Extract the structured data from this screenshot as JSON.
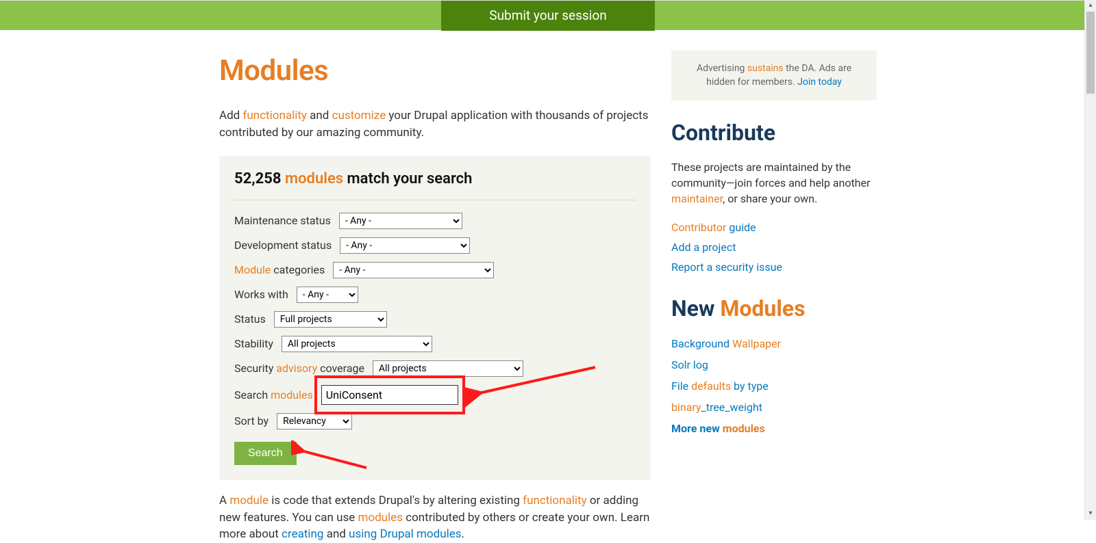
{
  "banner": {
    "cta": "Submit your session"
  },
  "page": {
    "title": "Modules",
    "intro_pre": "Add ",
    "intro_link1": "functionality",
    "intro_mid1": " and ",
    "intro_link2": "customize",
    "intro_post": " your Drupal application with thousands of projects contributed by our amazing community."
  },
  "search": {
    "count": "52,258",
    "word_modules": "modules",
    "heading_rest": " match your search",
    "filters": {
      "maintenance": {
        "label": "Maintenance status",
        "value": "- Any -"
      },
      "development": {
        "label": "Development status",
        "value": "- Any -"
      },
      "categories": {
        "label_pre": "",
        "label_link": "Module",
        "label_post": " categories",
        "value": "- Any -"
      },
      "works_with": {
        "label": "Works with",
        "value": "- Any -"
      },
      "status": {
        "label": "Status",
        "value": "Full projects"
      },
      "stability": {
        "label": "Stability",
        "value": "All projects"
      },
      "security": {
        "label_pre": "Security ",
        "label_link": "advisory",
        "label_post": " coverage",
        "value": "All projects"
      },
      "search_modules": {
        "label_pre": "Search ",
        "label_link": "modules",
        "value": "UniConsent"
      },
      "sort": {
        "label": "Sort by",
        "value": "Relevancy"
      }
    },
    "button": "Search"
  },
  "below": {
    "t1": "A ",
    "l1": "module",
    "t2": " is code that extends Drupal's by altering existing ",
    "l2": "functionality",
    "t3": " or adding new features. You can use ",
    "l3": "modules",
    "t4": " contributed by others or create your own. Learn more about ",
    "l4": "creating",
    "t5": " and ",
    "l5": "using Drupal modules",
    "t6": "."
  },
  "sidebar": {
    "ad": {
      "t1": "Advertising ",
      "l1": "sustains",
      "t2": " the DA. Ads are hidden for members. ",
      "l2": "Join today"
    },
    "contribute": {
      "heading": "Contribute",
      "para_t1": "These projects are maintained by the community—join forces and help another ",
      "para_l1": "maintainer",
      "para_t2": ", or share your own.",
      "links": {
        "contributor_o": "Contributor",
        "contributor_b": " guide",
        "add_project": "Add a project",
        "report": "Report a security issue"
      }
    },
    "new_modules": {
      "heading_navy": "New ",
      "heading_orange": "Modules",
      "items": [
        {
          "blue": "Background ",
          "orange": "Wallpaper"
        },
        {
          "blue": "Solr log",
          "orange": ""
        },
        {
          "blue": "File ",
          "orange": "defaults",
          "blue2": " by type"
        },
        {
          "blue": "",
          "orange": "binary",
          "blue2": "_tree_weight"
        }
      ],
      "more_navy": "More new ",
      "more_orange": "modules"
    }
  }
}
